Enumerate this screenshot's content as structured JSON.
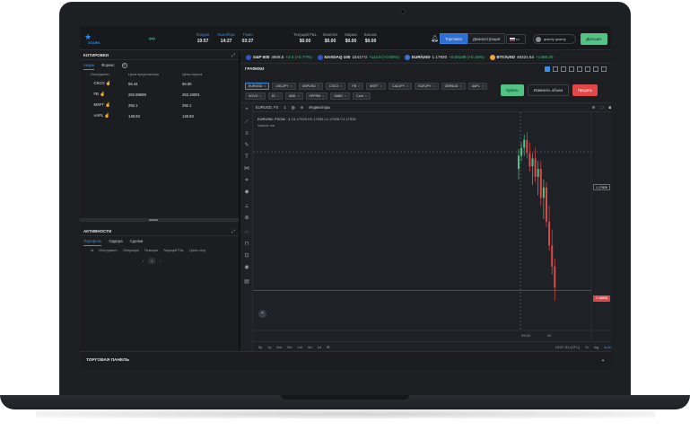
{
  "topbar": {
    "logo_text": "STARK",
    "clocks": [
      {
        "label": "Лондон",
        "value": "19:57"
      },
      {
        "label": "Нью-Йорк",
        "value": "14:27"
      },
      {
        "label": "Токио",
        "value": "03:27"
      }
    ],
    "stats": [
      {
        "label": "Текущий P&L",
        "value": "$0.00"
      },
      {
        "label": "Капитал",
        "value": "$0.00"
      },
      {
        "label": "Маржа",
        "value": "$0.00"
      },
      {
        "label": "Баланс",
        "value": "$0.00"
      }
    ],
    "mode_trading": "Торговля",
    "mode_demo": "Демонстрация",
    "language": "ru",
    "user_name": "qwerty qwerty",
    "deposit_label": "Депозит"
  },
  "quotes": {
    "title": "КОТИРОВКИ",
    "tabs": [
      "Акции",
      "Форекс"
    ],
    "columns": [
      "Инструмент",
      "Цена предложения",
      "Цена спроса"
    ],
    "rows": [
      {
        "symbol": "CSCO",
        "bid": "56.44",
        "ask": "56.50"
      },
      {
        "symbol": "FB",
        "bid": "262.89999",
        "ask": "263.19001"
      },
      {
        "symbol": "MSFT",
        "bid": "292.1",
        "ask": "292.1"
      },
      {
        "symbol": "AAPL",
        "bid": "148.93",
        "ask": "148.93"
      }
    ]
  },
  "activity": {
    "title": "АКТИВНОСТИ",
    "tabs": [
      "Портфель",
      "Ордера",
      "Сделки"
    ],
    "columns": [
      "Id",
      "Инструмент",
      "Операция",
      "Позиция",
      "Текущий P&L",
      "Цена откр"
    ],
    "pager": {
      "prev": "‹",
      "current": "1",
      "next": "›"
    }
  },
  "ticker": [
    {
      "name": "S&P 500",
      "price": "4508.6",
      "change": "+3.4 (+0.77%)",
      "dir": "up",
      "color": "#2f56c2"
    },
    {
      "name": "NASDAQ 100",
      "price": "15417.0",
      "change": "+114.8 (+0.80%)",
      "dir": "up",
      "color": "#2f56c2"
    },
    {
      "name": "EUR/USD",
      "price": "1.17930",
      "change": "+0.00189 (+0.16%)",
      "dir": "up",
      "color": "#3b6fd0"
    },
    {
      "name": "BTC/USD",
      "price": "48321.54",
      "change": "+1465.20",
      "dir": "up",
      "color": "#f2a33a"
    }
  ],
  "charts": {
    "title": "ГРАФИКИ",
    "chips": [
      "EURUSD",
      "USDJPY",
      "GBPUSD",
      "CSCO",
      "FB",
      "MSFT",
      "CADJPY",
      "EURJPY",
      "GBPAUD",
      "AAPL",
      "XOVO",
      "JD",
      "ABD",
      "XPFRM",
      "SABD",
      "Cont"
    ],
    "buy_label": "Купить",
    "amount_label": "Изменить объем",
    "sell_label": "Продать",
    "symbol_label": "EURUSD, FX",
    "interval": "1",
    "indicators_label": "Индикаторы",
    "ohlc_text": "EURUSD: FXCM · 1",
    "ohlc_values": "O1.17929 H1.17930 L1.17928 C1.17930",
    "volume_label": "Volume  n/a",
    "price_current": "1.17929",
    "price_low": "1.16868",
    "x_labels": [
      "09:00",
      "20"
    ],
    "periods": [
      "5y",
      "1y",
      "6m",
      "3m",
      "1m",
      "5d",
      "1d"
    ],
    "time_text": "19:57:31 (UTC)",
    "pct_label": "%",
    "log_label": "log",
    "auto_label": "auto"
  },
  "chart_data": {
    "type": "candlestick",
    "title": "EURUSD, 1",
    "x_ticks": [
      "09:00",
      "20"
    ],
    "price_markers": [
      "1.17929",
      "1.16868"
    ],
    "series": [
      {
        "o": 1.178,
        "h": 1.1795,
        "l": 1.1772,
        "c": 1.179
      },
      {
        "o": 1.179,
        "h": 1.18,
        "l": 1.1786,
        "c": 1.1796
      },
      {
        "o": 1.1796,
        "h": 1.1806,
        "l": 1.179,
        "c": 1.1802
      },
      {
        "o": 1.1802,
        "h": 1.1808,
        "l": 1.1788,
        "c": 1.1792
      },
      {
        "o": 1.1792,
        "h": 1.18,
        "l": 1.1778,
        "c": 1.1782
      },
      {
        "o": 1.1782,
        "h": 1.1792,
        "l": 1.1768,
        "c": 1.1788
      },
      {
        "o": 1.1788,
        "h": 1.1796,
        "l": 1.177,
        "c": 1.1774
      },
      {
        "o": 1.1774,
        "h": 1.1786,
        "l": 1.176,
        "c": 1.178
      },
      {
        "o": 1.178,
        "h": 1.1786,
        "l": 1.1752,
        "c": 1.1758
      },
      {
        "o": 1.1758,
        "h": 1.1772,
        "l": 1.1742,
        "c": 1.1766
      },
      {
        "o": 1.1766,
        "h": 1.177,
        "l": 1.1736,
        "c": 1.174
      },
      {
        "o": 1.174,
        "h": 1.1752,
        "l": 1.1718,
        "c": 1.1722
      },
      {
        "o": 1.1722,
        "h": 1.1734,
        "l": 1.17,
        "c": 1.1706
      },
      {
        "o": 1.1706,
        "h": 1.1712,
        "l": 1.168,
        "c": 1.169
      }
    ]
  },
  "tradepanel": {
    "title": "ТОРГОВАЯ ПАНЕЛЬ"
  }
}
